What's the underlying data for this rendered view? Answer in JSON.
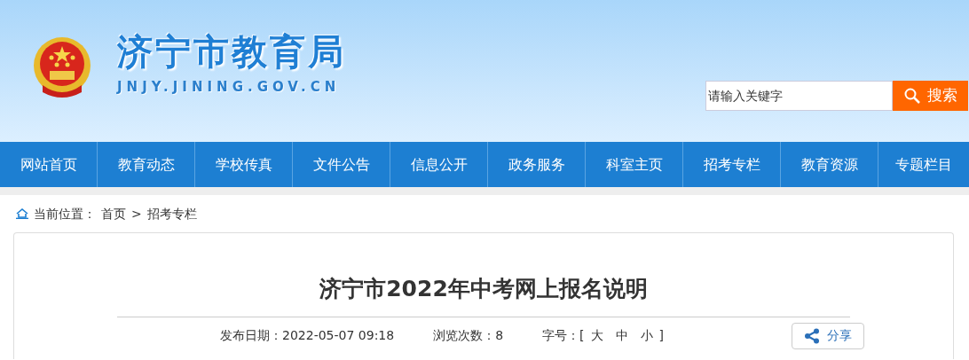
{
  "header": {
    "site_title": "济宁市教育局",
    "domain": "JNJY.JINING.GOV.CN",
    "search": {
      "placeholder": "请输入关键字",
      "button": "搜索"
    }
  },
  "nav": [
    {
      "label": "网站首页"
    },
    {
      "label": "教育动态"
    },
    {
      "label": "学校传真"
    },
    {
      "label": "文件公告"
    },
    {
      "label": "信息公开"
    },
    {
      "label": "政务服务"
    },
    {
      "label": "科室主页"
    },
    {
      "label": "招考专栏"
    },
    {
      "label": "教育资源"
    },
    {
      "label": "专题栏目"
    }
  ],
  "breadcrumb": {
    "label": "当前位置：",
    "items": [
      "首页",
      "招考专栏"
    ],
    "separator": ">"
  },
  "article": {
    "title": "济宁市2022年中考网上报名说明",
    "date": "发布日期：2022-05-07 09:18",
    "views": "浏览次数：8",
    "font_size": {
      "label": "字号：",
      "open": "[",
      "options": [
        "大",
        "中",
        "小"
      ],
      "close": "]"
    },
    "share": "分享"
  }
}
